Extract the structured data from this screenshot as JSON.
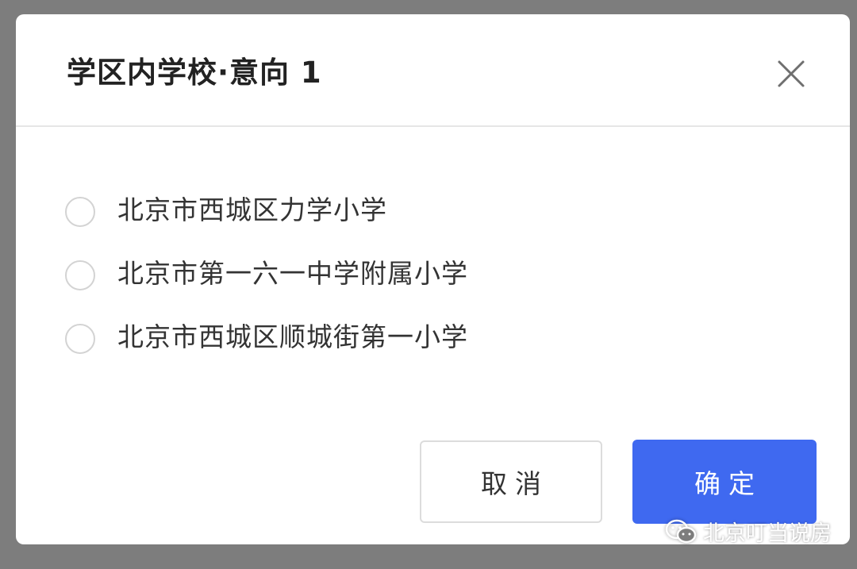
{
  "dialog": {
    "title": "学区内学校·意向 1",
    "close_icon": "close-icon"
  },
  "options": [
    {
      "label": "北京市西城区力学小学",
      "selected": false
    },
    {
      "label": "北京市第一六一中学附属小学",
      "selected": false
    },
    {
      "label": "北京市西城区顺城街第一小学",
      "selected": false
    }
  ],
  "buttons": {
    "cancel_label": "取消",
    "ok_label": "确定"
  },
  "watermark": {
    "text": "北京叮当说房",
    "icon": "wechat-icon"
  },
  "colors": {
    "primary": "#3f69f0",
    "overlay": "#7d7d7d"
  }
}
